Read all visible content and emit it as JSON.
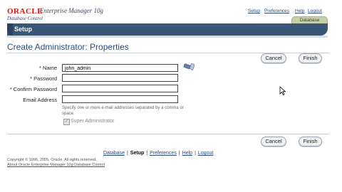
{
  "header": {
    "brand": "ORACLE",
    "product": "Enterprise Manager 10g",
    "subproduct": "Database Control",
    "global_links": [
      "Setup",
      "Preferences",
      "Help",
      "Logout"
    ],
    "context_tab": "Database",
    "section_tab": "Setup"
  },
  "page": {
    "title": "Create Administrator: Properties",
    "buttons": {
      "cancel": "Cancel",
      "finish": "Finish"
    }
  },
  "form": {
    "name_label": "* Name",
    "name_value": "john_admin",
    "password_label": "* Password",
    "password_value": "",
    "confirm_label": "* Confirm Password",
    "confirm_value": "",
    "email_label": "Email Address",
    "email_value": "",
    "email_hint": "Specify one or more e-mail addresses separated by a comma or space.",
    "super_admin_label": "Super Administrator",
    "super_admin_checked": true
  },
  "footer": {
    "links": [
      "Database",
      "Setup",
      "Preferences",
      "Help",
      "Logout"
    ],
    "active": "Setup",
    "copyright": "Copyright © 1996, 2005, Oracle. All rights reserved.",
    "about": "About Oracle Enterprise Manager 10g Database Control"
  }
}
